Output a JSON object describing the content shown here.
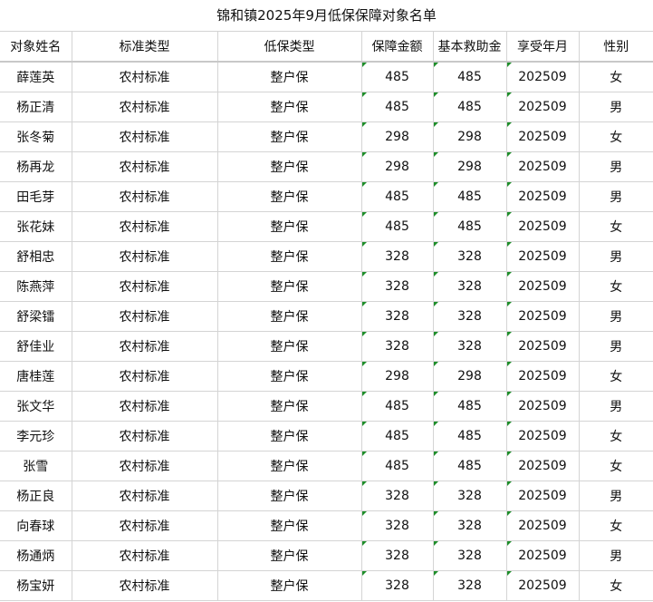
{
  "title": "锦和镇2025年9月低保保障对象名单",
  "headers": [
    "对象姓名",
    "标准类型",
    "低保类型",
    "保障金额",
    "基本救助金",
    "享受年月",
    "性别"
  ],
  "rows": [
    [
      "薛莲英",
      "农村标准",
      "整户保",
      "485",
      "485",
      "202509",
      "女"
    ],
    [
      "杨正清",
      "农村标准",
      "整户保",
      "485",
      "485",
      "202509",
      "男"
    ],
    [
      "张冬菊",
      "农村标准",
      "整户保",
      "298",
      "298",
      "202509",
      "女"
    ],
    [
      "杨再龙",
      "农村标准",
      "整户保",
      "298",
      "298",
      "202509",
      "男"
    ],
    [
      "田毛芽",
      "农村标准",
      "整户保",
      "485",
      "485",
      "202509",
      "男"
    ],
    [
      "张花妹",
      "农村标准",
      "整户保",
      "485",
      "485",
      "202509",
      "女"
    ],
    [
      "舒相忠",
      "农村标准",
      "整户保",
      "328",
      "328",
      "202509",
      "男"
    ],
    [
      "陈燕萍",
      "农村标准",
      "整户保",
      "328",
      "328",
      "202509",
      "女"
    ],
    [
      "舒梁镭",
      "农村标准",
      "整户保",
      "328",
      "328",
      "202509",
      "男"
    ],
    [
      "舒佳业",
      "农村标准",
      "整户保",
      "328",
      "328",
      "202509",
      "男"
    ],
    [
      "唐桂莲",
      "农村标准",
      "整户保",
      "298",
      "298",
      "202509",
      "女"
    ],
    [
      "张文华",
      "农村标准",
      "整户保",
      "485",
      "485",
      "202509",
      "男"
    ],
    [
      "李元珍",
      "农村标准",
      "整户保",
      "485",
      "485",
      "202509",
      "女"
    ],
    [
      "张雪",
      "农村标准",
      "整户保",
      "485",
      "485",
      "202509",
      "女"
    ],
    [
      "杨正良",
      "农村标准",
      "整户保",
      "328",
      "328",
      "202509",
      "男"
    ],
    [
      "向春球",
      "农村标准",
      "整户保",
      "328",
      "328",
      "202509",
      "女"
    ],
    [
      "杨通炳",
      "农村标准",
      "整户保",
      "328",
      "328",
      "202509",
      "男"
    ],
    [
      "杨宝妍",
      "农村标准",
      "整户保",
      "328",
      "328",
      "202509",
      "女"
    ]
  ],
  "colors": {
    "grid": "#d4d4d4",
    "marker": "#1e8e2a"
  },
  "icons": {
    "number-stored-as-text-marker": "green-corner-triangle"
  }
}
